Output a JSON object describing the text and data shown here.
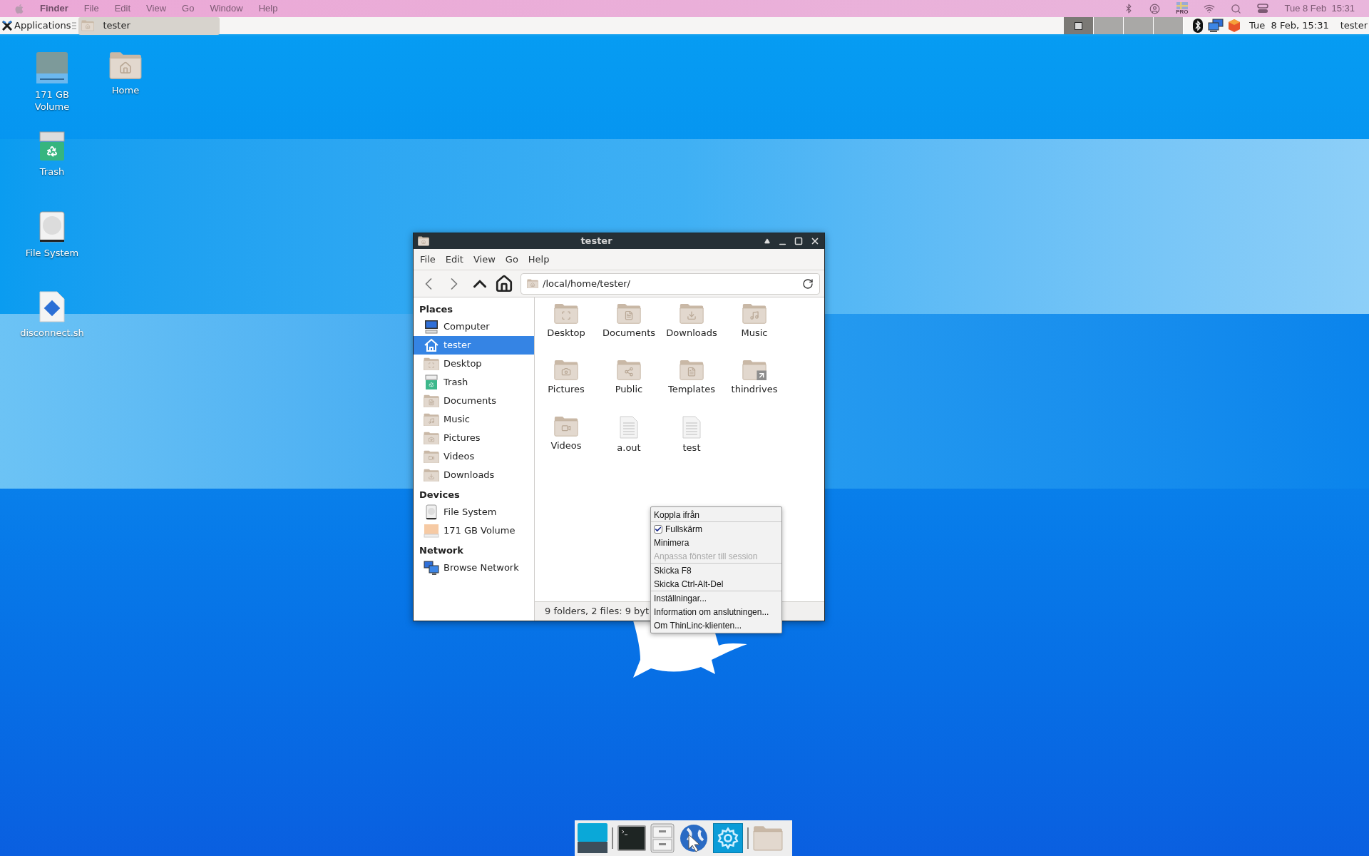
{
  "mac_menubar": {
    "app": "Finder",
    "menus": [
      "File",
      "Edit",
      "View",
      "Go",
      "Window",
      "Help"
    ],
    "flag_label": "PRO",
    "clock": "Tue 8 Feb  15:31"
  },
  "panel": {
    "applications": "Applications",
    "tasks": [
      {
        "label": "tester",
        "selected": true
      }
    ],
    "workspaces": [
      {
        "selected": true
      },
      {
        "selected": false
      },
      {
        "selected": false
      },
      {
        "selected": false
      }
    ],
    "clock": "Tue  8 Feb, 15:31",
    "user": "tester"
  },
  "desktop_icons": [
    {
      "label": "171 GB Volume",
      "kind": "volume"
    },
    {
      "label": "Home",
      "kind": "home"
    },
    {
      "label": "Trash",
      "kind": "trash"
    },
    {
      "label": "File System",
      "kind": "drive"
    },
    {
      "label": "disconnect.sh",
      "kind": "script"
    }
  ],
  "window": {
    "title": "tester",
    "menus": [
      "File",
      "Edit",
      "View",
      "Go",
      "Help"
    ],
    "location": "/local/home/tester/",
    "sidebar": [
      {
        "title": "Places",
        "items": [
          {
            "label": "Computer",
            "kind": "computer",
            "selected": false
          },
          {
            "label": "tester",
            "kind": "home",
            "selected": true
          },
          {
            "label": "Desktop",
            "kind": "desktop",
            "selected": false
          },
          {
            "label": "Trash",
            "kind": "trash",
            "selected": false
          },
          {
            "label": "Documents",
            "kind": "documents",
            "selected": false
          },
          {
            "label": "Music",
            "kind": "music",
            "selected": false
          },
          {
            "label": "Pictures",
            "kind": "pictures",
            "selected": false
          },
          {
            "label": "Videos",
            "kind": "videos",
            "selected": false
          },
          {
            "label": "Downloads",
            "kind": "downloads",
            "selected": false
          }
        ]
      },
      {
        "title": "Devices",
        "items": [
          {
            "label": "File System",
            "kind": "drive",
            "selected": false
          },
          {
            "label": "171 GB Volume",
            "kind": "volume",
            "selected": false
          }
        ]
      },
      {
        "title": "Network",
        "items": [
          {
            "label": "Browse Network",
            "kind": "network",
            "selected": false
          }
        ]
      }
    ],
    "files": [
      {
        "label": "Desktop",
        "kind": "desktop"
      },
      {
        "label": "Documents",
        "kind": "documents"
      },
      {
        "label": "Downloads",
        "kind": "downloads"
      },
      {
        "label": "Music",
        "kind": "music"
      },
      {
        "label": "Pictures",
        "kind": "pictures"
      },
      {
        "label": "Public",
        "kind": "public"
      },
      {
        "label": "Templates",
        "kind": "templates"
      },
      {
        "label": "thindrives",
        "kind": "link"
      },
      {
        "label": "Videos",
        "kind": "videos"
      },
      {
        "label": "a.out",
        "kind": "file"
      },
      {
        "label": "test",
        "kind": "file"
      }
    ],
    "status": "9 folders, 2 files: 9 byt"
  },
  "context_menu": {
    "groups": [
      [
        {
          "label": "Koppla ifrån",
          "kind": "item",
          "disabled": false
        }
      ],
      [
        {
          "label": "Fullskärm",
          "kind": "check",
          "checked": true,
          "disabled": false
        },
        {
          "label": "Minimera",
          "kind": "item",
          "disabled": false
        },
        {
          "label": "Anpassa fönster till session",
          "kind": "item",
          "disabled": true
        }
      ],
      [
        {
          "label": "Skicka F8",
          "kind": "item",
          "disabled": false
        },
        {
          "label": "Skicka Ctrl-Alt-Del",
          "kind": "item",
          "disabled": false
        }
      ],
      [
        {
          "label": "Inställningar...",
          "kind": "item",
          "disabled": false
        },
        {
          "label": "Information om anslutningen...",
          "kind": "item",
          "disabled": false
        },
        {
          "label": "Om ThinLinc-klienten...",
          "kind": "item",
          "disabled": false
        }
      ]
    ]
  }
}
